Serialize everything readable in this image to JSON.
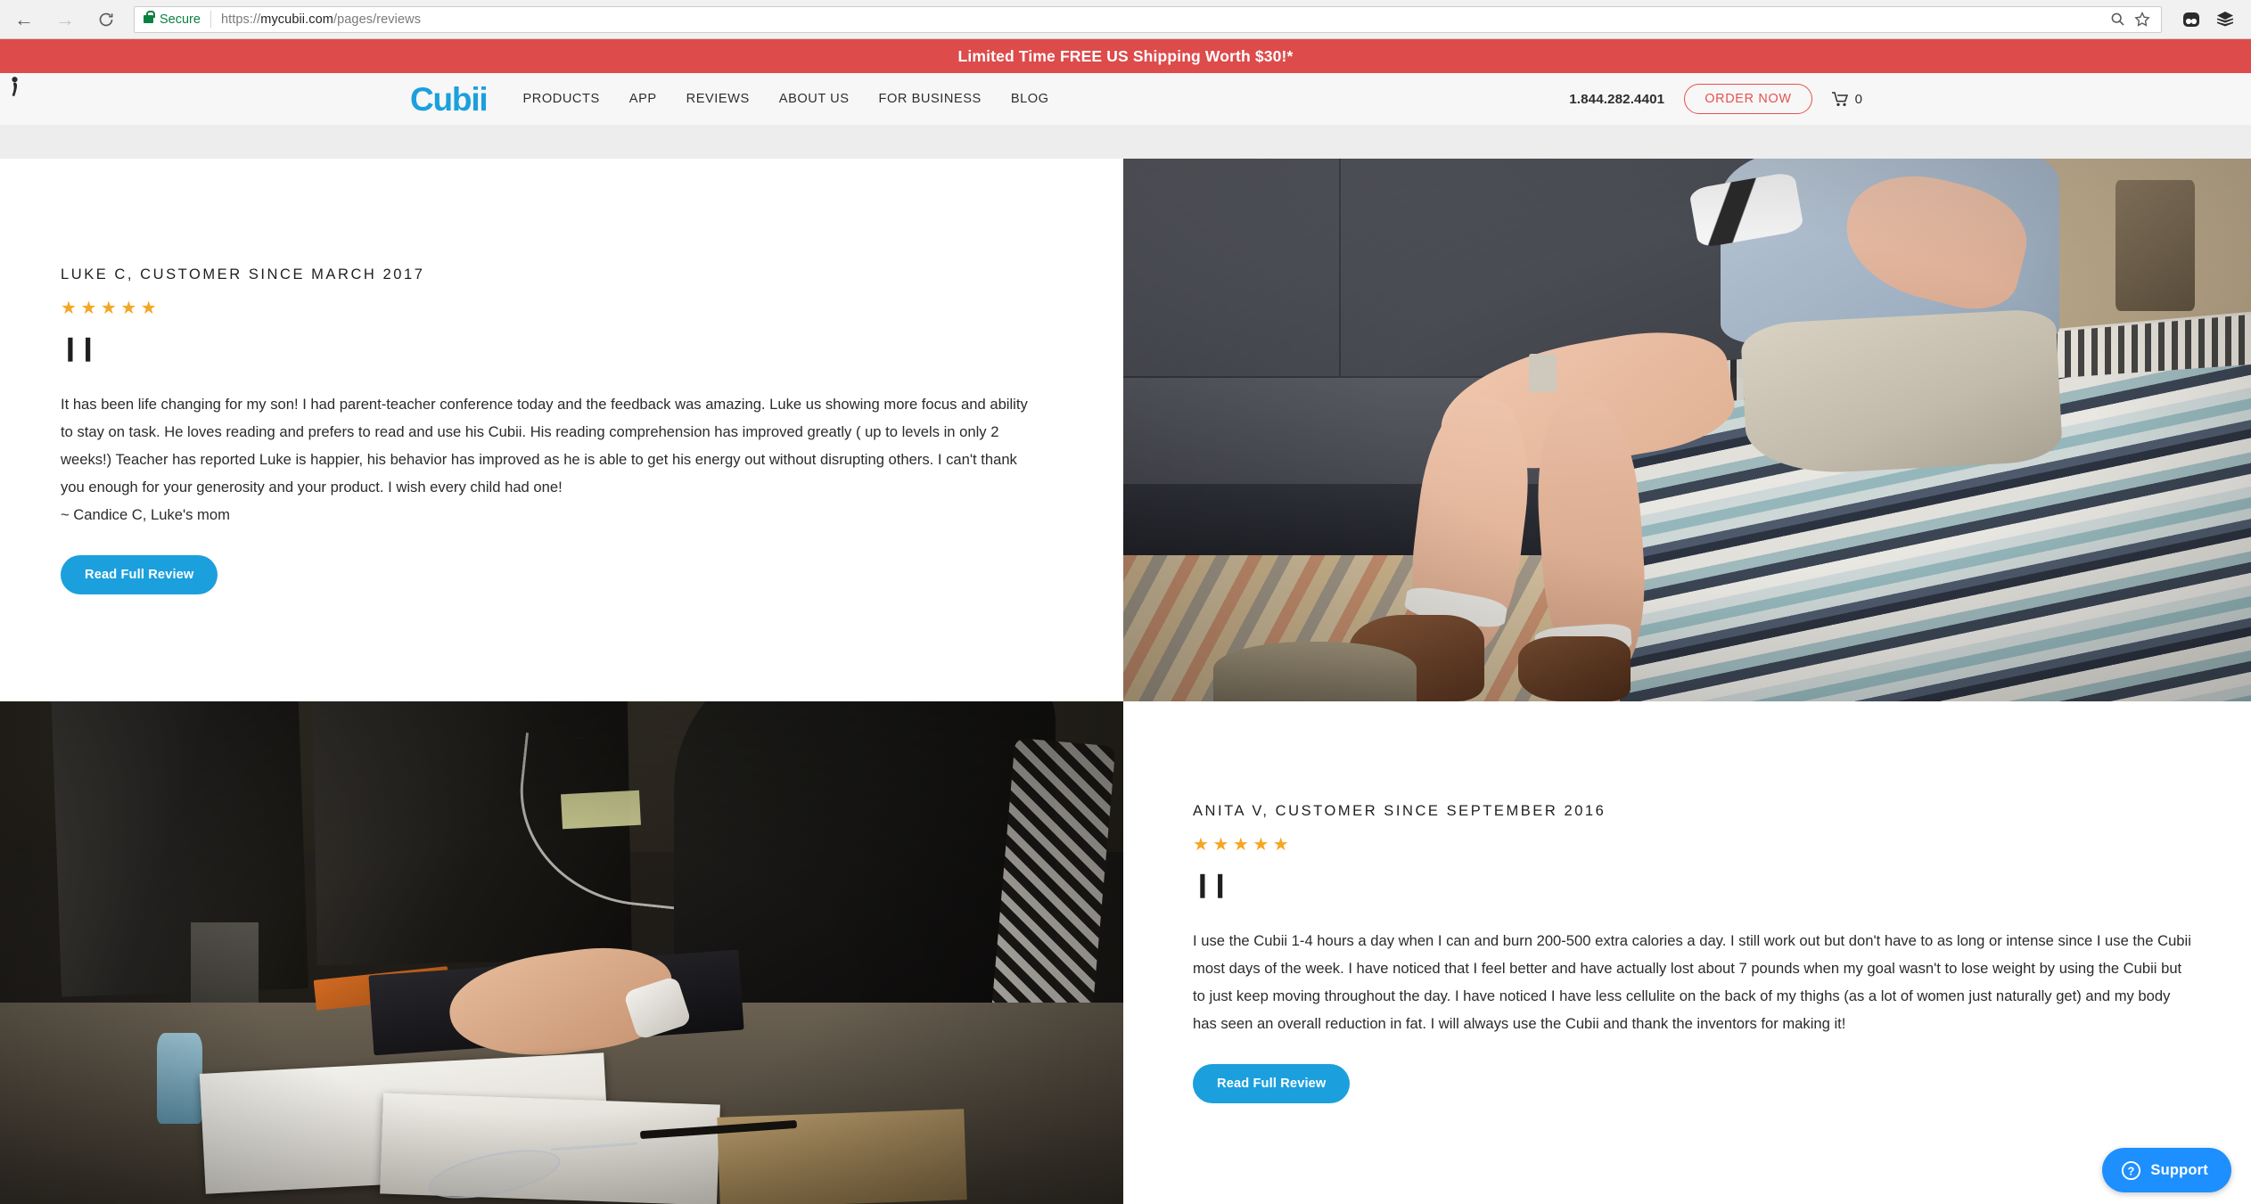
{
  "browser": {
    "back_icon": "back-arrow-icon",
    "forward_icon": "forward-arrow-icon",
    "reload_icon": "reload-icon",
    "security_label": "Secure",
    "url_scheme": "https://",
    "url_host": "mycubii.com",
    "url_path": "/pages/reviews",
    "url_full": "https://mycubii.com/pages/reviews",
    "zoom_icon": "search-zoom-icon",
    "bookmark_icon": "star-bookmark-icon",
    "extension_1": "extension-icon",
    "extension_2": "layers-extension-icon"
  },
  "promo": {
    "text": "Limited Time FREE US Shipping Worth $30!*",
    "background_color": "#dd4b4b",
    "text_color": "#ffffff"
  },
  "header": {
    "logo_text": "Cubii",
    "logo_color": "#1ba0dd",
    "nav": [
      {
        "label": "PRODUCTS"
      },
      {
        "label": "APP"
      },
      {
        "label": "REVIEWS"
      },
      {
        "label": "ABOUT US"
      },
      {
        "label": "FOR BUSINESS"
      },
      {
        "label": "BLOG"
      }
    ],
    "phone": "1.844.282.4401",
    "order_now_label": "ORDER NOW",
    "order_now_color": "#e8514f",
    "cart_icon": "shopping-cart-icon",
    "cart_count": "0"
  },
  "reviews": [
    {
      "name_line": "LUKE C, CUSTOMER SINCE MARCH 2017",
      "rating": 5,
      "star_color": "#f5a623",
      "quote_glyph": "❙❙",
      "body": "It has been life changing for my son! I had parent-teacher conference today and the feedback was amazing. Luke us showing more focus and ability to stay on task. He loves reading and prefers to read and use his Cubii. His reading comprehension has improved greatly ( up to levels in only 2 weeks!) Teacher has reported Luke is happier, his behavior has improved as he is able to get his energy out without disrupting others. I can't thank you enough for your generosity and your product. I wish every child had one!",
      "signature": "~ Candice C, Luke's mom",
      "button_label": "Read Full Review",
      "button_color": "#1ba0dd",
      "photo_alt": "boy-sitting-on-bed-with-game-controller-using-cubii"
    },
    {
      "name_line": "ANITA V, CUSTOMER SINCE SEPTEMBER 2016",
      "rating": 5,
      "star_color": "#f5a623",
      "quote_glyph": "❙❙",
      "body": "I use the Cubii 1-4 hours a day when I can and burn 200-500 extra calories a day. I still work out but don't have to as long or intense since I use the Cubii most days of the week. I have noticed that I feel better and have actually lost about 7 pounds when my goal wasn't to lose weight by using the Cubii but to just keep moving throughout the day. I have noticed I have less cellulite on the back of my thighs (as a lot of women just naturally get) and my body has seen an overall reduction in fat. I will always use the Cubii and thank the inventors for making it!",
      "signature": "",
      "button_label": "Read Full Review",
      "button_color": "#1ba0dd",
      "photo_alt": "person-typing-at-office-desk-using-cubii-under-desk"
    }
  ],
  "support": {
    "label": "Support",
    "icon": "question-circle-icon",
    "background_color": "#1e8fff"
  }
}
